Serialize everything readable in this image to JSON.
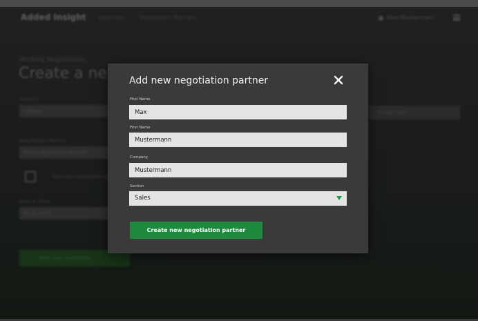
{
  "background": {
    "brand": "Added Insight",
    "nav_links": [
      "Overview",
      "Negotiation Partners"
    ],
    "user_name": "Max Mustermann",
    "breadcrumb": "Working Negotiations",
    "heading": "Create a new",
    "labels": [
      "Subject",
      "Negotiation Partner",
      "Date & Time"
    ],
    "fields": [
      "Subject",
      "Select negotiation partner",
      "01.01.2019"
    ],
    "checkbox_label": "Add new negotiation partner",
    "right_field": "Mustermann",
    "green_button": "Start new negotiation"
  },
  "modal": {
    "title": "Add new negotiation partner",
    "fields": [
      {
        "label": "First Name",
        "value": "Max"
      },
      {
        "label": "First Name",
        "value": "Mustermann"
      },
      {
        "label": "Company",
        "value": "Mustermann"
      }
    ],
    "section": {
      "label": "Section",
      "value": "Sales"
    },
    "submit_label": "Create new negotiation partner"
  },
  "colors": {
    "accent": "#1e8a3e",
    "modal_background": "#3a3a3a",
    "field_background": "#e4e4e4",
    "arrow": "#1e9e4a"
  },
  "icons": {
    "close": "close-icon",
    "dropdown": "chevron-down-icon",
    "menu": "hamburger-icon",
    "user": "user-icon"
  }
}
